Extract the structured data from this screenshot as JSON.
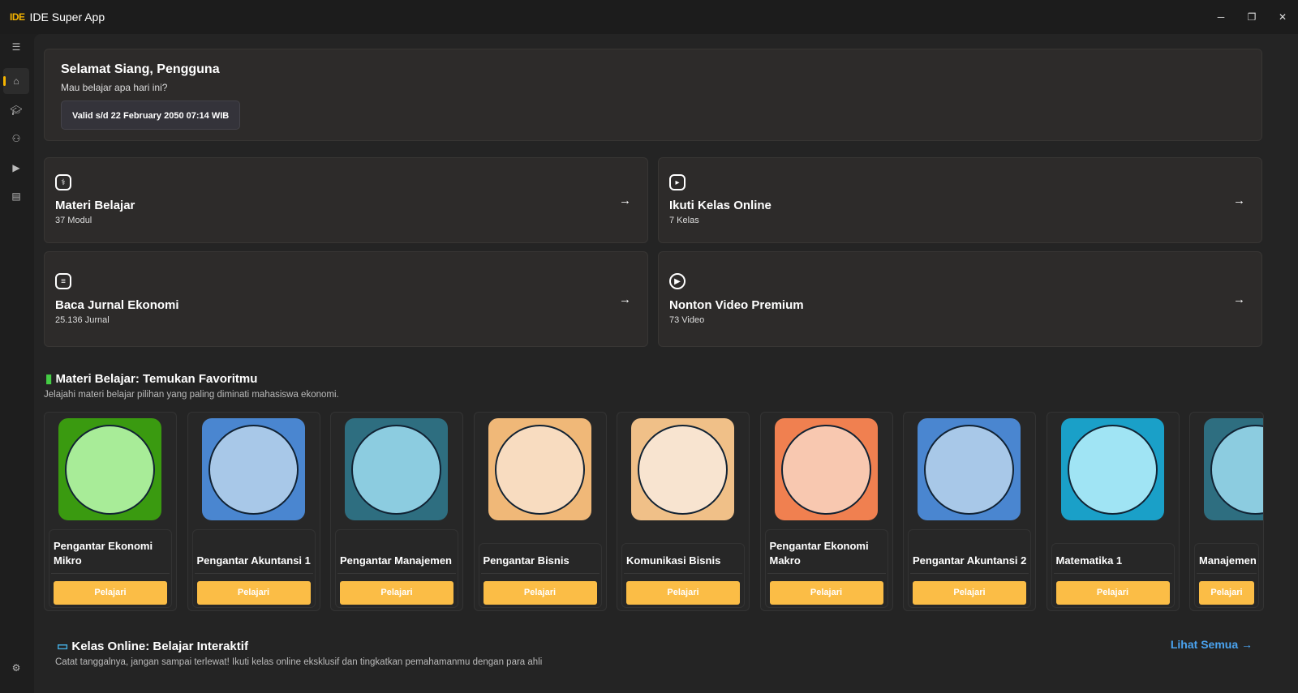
{
  "app": {
    "logo": "IDE",
    "title": "IDE Super App"
  },
  "window": {
    "minimize": "─",
    "maximize": "❐",
    "close": "✕"
  },
  "sidebar": {
    "items": [
      "menu-icon",
      "home-icon",
      "graduation-cap-icon",
      "users-icon",
      "play-icon",
      "document-icon",
      "settings-icon"
    ],
    "active": "home",
    "accent": "#f5b400"
  },
  "greeting": {
    "title": "Selamat Siang, Pengguna",
    "subtitle": "Mau belajar apa hari ini?",
    "valid": "Valid s/d 22 February 2050 07:14 WIB"
  },
  "quick": [
    {
      "title": "Materi Belajar",
      "sub": "37 Modul",
      "icon": "stethoscope-icon"
    },
    {
      "title": "Ikuti Kelas Online",
      "sub": "7 Kelas",
      "icon": "video-icon"
    },
    {
      "title": "Baca Jurnal Ekonomi",
      "sub": "25.136 Jurnal",
      "icon": "journal-icon"
    },
    {
      "title": "Nonton Video Premium",
      "sub": "73 Video",
      "icon": "play-circle-icon"
    }
  ],
  "materi": {
    "title": "Materi Belajar: Temukan Favoritmu",
    "subtitle": "Jelajahi materi belajar pilihan yang paling diminati mahasiswa ekonomi.",
    "button": "Pelajari",
    "courses": [
      {
        "name": "Pengantar Ekonomi Mikro",
        "bg": "#3a9a10",
        "circle": "#a8ec98"
      },
      {
        "name": "Pengantar Akuntansi 1",
        "bg": "#4a86d0",
        "circle": "#a8c8e8"
      },
      {
        "name": "Pengantar Manajemen",
        "bg": "#2e6e80",
        "circle": "#8ccce0"
      },
      {
        "name": "Pengantar Bisnis",
        "bg": "#f0b878",
        "circle": "#f8dcc0"
      },
      {
        "name": "Komunikasi Bisnis",
        "bg": "#f0c088",
        "circle": "#f8e4d0"
      },
      {
        "name": "Pengantar Ekonomi Makro",
        "bg": "#f08050",
        "circle": "#f8c8b0"
      },
      {
        "name": "Pengantar Akuntansi 2",
        "bg": "#4a86d0",
        "circle": "#a8c8e8"
      },
      {
        "name": "Matematika 1",
        "bg": "#1aa0c8",
        "circle": "#a0e4f4"
      },
      {
        "name": "Manajemen",
        "bg": "#2e6e80",
        "circle": "#8ccce0"
      }
    ]
  },
  "kelas": {
    "title": "Kelas Online: Belajar Interaktif",
    "subtitle": "Catat tanggalnya, jangan sampai terlewat! Ikuti kelas online eksklusif dan tingkatkan pemahamanmu dengan para ahli",
    "see_all": "Lihat Semua"
  }
}
